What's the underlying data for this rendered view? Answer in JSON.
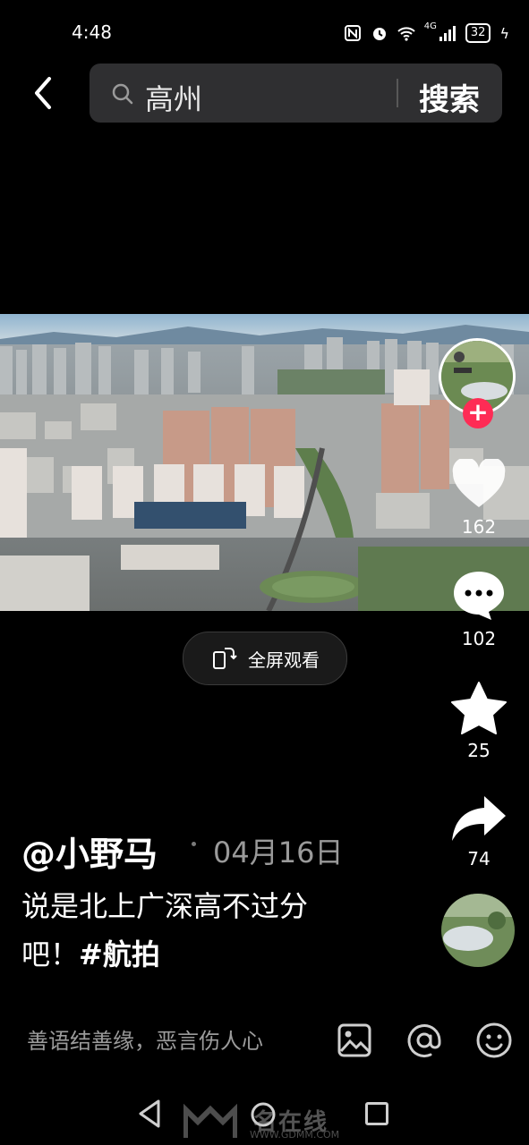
{
  "status_bar": {
    "time": "4:48",
    "battery": "32",
    "network": "4G"
  },
  "search": {
    "query": "高州",
    "button_label": "搜索"
  },
  "video": {
    "fullscreen_label": "全屏观看"
  },
  "actions": {
    "likes": "162",
    "comments": "102",
    "favorites": "25",
    "shares": "74"
  },
  "post": {
    "author": "@小野马",
    "date": "04月16日",
    "caption_line1": "说是北上广深高不过分",
    "caption_line2_prefix": "吧！",
    "hashtag": "#航拍"
  },
  "comment_bar": {
    "placeholder": "善语结善缘，恶言伤人心"
  },
  "watermark": {
    "brand": "名在线",
    "url": "WWW.GDMM.COM"
  },
  "colors": {
    "accent": "#fe2c55",
    "search_bg": "#2f2f31",
    "muted": "#9b9b9b"
  }
}
